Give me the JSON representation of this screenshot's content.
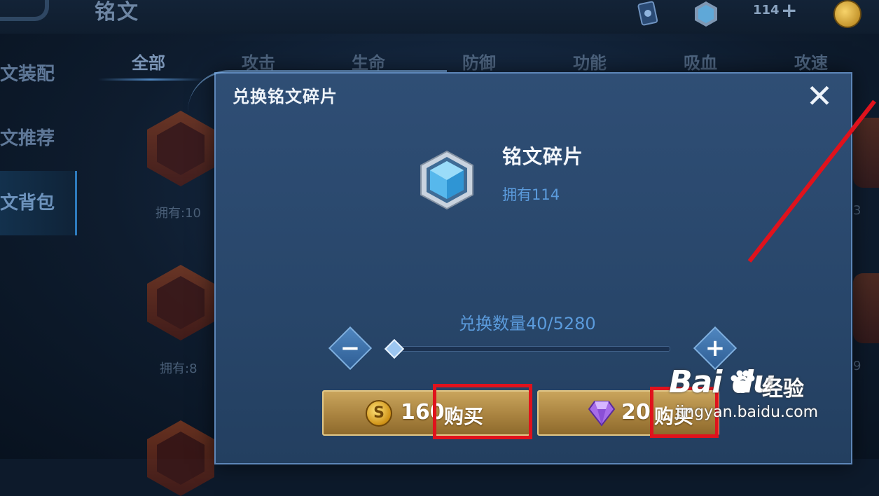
{
  "header": {
    "title": "铭文",
    "fragment_count": "114",
    "plus": "+"
  },
  "sidebar": {
    "items": [
      {
        "label": "文装配"
      },
      {
        "label": "文推荐"
      },
      {
        "label": "文背包"
      }
    ]
  },
  "tabs": [
    {
      "label": "全部"
    },
    {
      "label": "攻击"
    },
    {
      "label": "生命"
    },
    {
      "label": "防御"
    },
    {
      "label": "功能"
    },
    {
      "label": "吸血"
    },
    {
      "label": "攻速"
    }
  ],
  "runes": [
    {
      "owned": "拥有:10"
    },
    {
      "owned": "拥有:8"
    }
  ],
  "right_counts": [
    "3",
    "9"
  ],
  "dialog": {
    "title": "兑换铭文碎片",
    "close": "✕",
    "item_name": "铭文碎片",
    "item_owned": "拥有114",
    "quantity_label": "兑换数量40/5280",
    "quantity": {
      "current": 40,
      "max": 5280
    },
    "minus": "−",
    "plus": "+",
    "gold_price": "160",
    "gold_buy_label": "购买",
    "gold_coin_glyph": "S",
    "gem_price": "20",
    "gem_buy_label": "购买"
  },
  "watermark": {
    "brand": "Bai  du",
    "sub": "经验",
    "url": "jingyan.baidu.com"
  },
  "colors": {
    "dialog_bg": "#2f4e75",
    "accent_blue": "#5b9bdc",
    "buy_button_gold": "#c9a55c",
    "highlight_red": "#e0121c"
  },
  "icons": [
    "back-arrow-icon",
    "card-icon",
    "fragment-icon",
    "gold-coin-icon",
    "close-icon",
    "minus-icon",
    "plus-icon",
    "gem-icon"
  ]
}
